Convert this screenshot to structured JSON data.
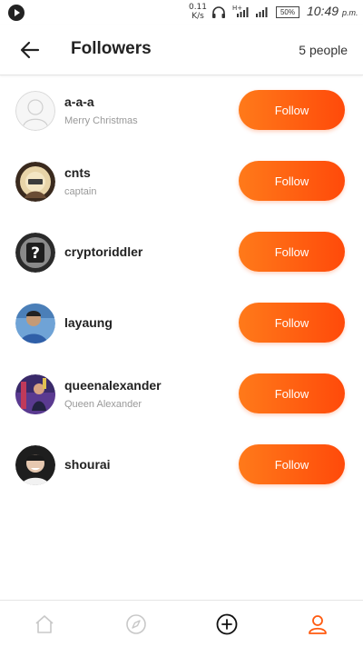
{
  "status_bar": {
    "speed_value": "0.11",
    "speed_unit": "K/s",
    "battery": "50%",
    "time": "10:49",
    "ampm": "p.m."
  },
  "header": {
    "title": "Followers",
    "count": "5 people"
  },
  "followers": [
    {
      "name": "a-a-a",
      "subtitle": "Merry Christmas",
      "button": "Follow"
    },
    {
      "name": "cnts",
      "subtitle": "captain",
      "button": "Follow"
    },
    {
      "name": "cryptoriddler",
      "subtitle": "",
      "button": "Follow"
    },
    {
      "name": "layaung",
      "subtitle": "",
      "button": "Follow"
    },
    {
      "name": "queenalexander",
      "subtitle": "Queen Alexander",
      "button": "Follow"
    },
    {
      "name": "shourai",
      "subtitle": "",
      "button": "Follow"
    }
  ],
  "bottom_nav": {
    "items": [
      "home-icon",
      "compass-icon",
      "add-icon",
      "profile-icon"
    ],
    "active": "profile-icon"
  },
  "colors": {
    "accent": "#ff5a0f",
    "inactive_icon": "#c8c8c8",
    "subtitle": "#999999"
  }
}
